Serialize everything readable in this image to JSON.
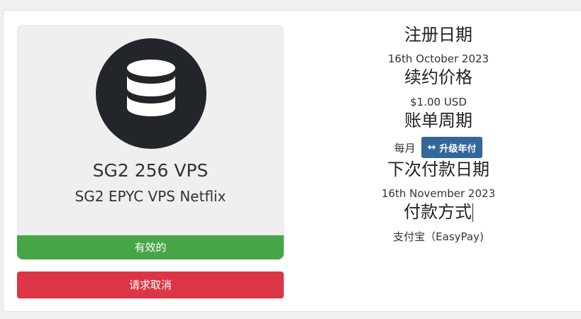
{
  "product": {
    "icon": "database-icon",
    "name": "SG2 256 VPS",
    "group": "SG2 EPYC VPS Netflix",
    "status": "有效的",
    "cancel_label": "请求取消"
  },
  "details": {
    "registration_label": "注册日期",
    "registration_value": "16th October 2023",
    "renewal_label": "续约价格",
    "renewal_value": "$1.00 USD",
    "billing_cycle_label": "账单周期",
    "billing_cycle_value": "每月",
    "upgrade_label": "升级年付",
    "next_due_label": "下次付款日期",
    "next_due_value": "16th November 2023",
    "payment_method_label": "付款方式",
    "payment_method_value": "支付宝（EasyPay)"
  },
  "colors": {
    "status": "#46a546",
    "cancel": "#dc3545",
    "upgrade": "#336699",
    "icon_circle": "#222529"
  }
}
